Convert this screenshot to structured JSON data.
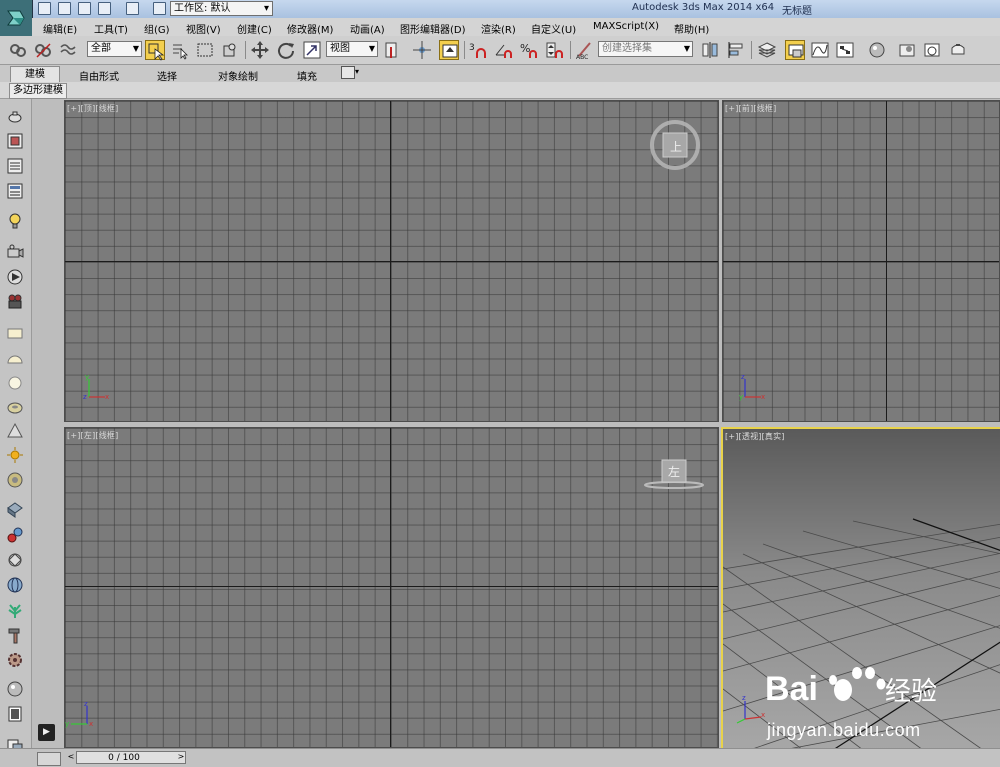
{
  "titlebar": {
    "workspace_label": "工作区: 默认",
    "app_title": "Autodesk 3ds Max  2014 x64",
    "doc_title": "无标题"
  },
  "menubar": {
    "items": [
      "编辑(E)",
      "工具(T)",
      "组(G)",
      "视图(V)",
      "创建(C)",
      "修改器(M)",
      "动画(A)",
      "图形编辑器(D)",
      "渲染(R)",
      "自定义(U)",
      "MAXScript(X)",
      "帮助(H)"
    ]
  },
  "toolbar": {
    "selection_filter": "全部",
    "reference_coord": "视图",
    "snap_count": "3",
    "named_selection_placeholder": "创建选择集"
  },
  "ribbon": {
    "tabs": [
      "建模",
      "自由形式",
      "选择",
      "对象绘制",
      "填充"
    ],
    "panel_label": "多边形建模"
  },
  "viewports": {
    "top": {
      "label": "[+][顶][线框]",
      "cube_label": "上"
    },
    "front": {
      "label": "[+][前][线框]"
    },
    "left": {
      "label": "[+][左][线框]",
      "cube_label": "左"
    },
    "persp": {
      "label": "[+][透视][真实]"
    }
  },
  "timeline": {
    "frame_readout": "0 / 100",
    "prev_arrow": "<",
    "next_arrow": ">"
  },
  "watermark": {
    "brand": "Bai",
    "brand_cn": "经验",
    "url": "jingyan.baidu.com"
  },
  "colors": {
    "active_button": "#f3cf4e",
    "viewport_bg": "#7b7b7b",
    "active_viewport_border": "#e8d24a",
    "title_bar": "#b6cbe6"
  }
}
